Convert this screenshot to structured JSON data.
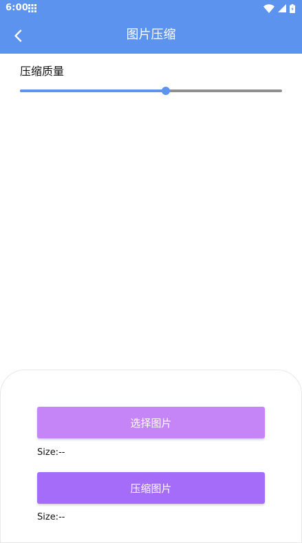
{
  "status_bar": {
    "time": "6:00"
  },
  "app_bar": {
    "title": "图片压缩",
    "color": "#5b93ee"
  },
  "quality": {
    "label": "压缩质量",
    "value_fraction": 0.556
  },
  "actions": {
    "select_label": "选择图片",
    "select_color": "#c685f6",
    "select_size": "Size:--",
    "compress_label": "压缩图片",
    "compress_color": "#a46cf8",
    "compress_size": "Size:--"
  },
  "icons": {
    "back": "back-arrow-icon",
    "grid": "grid-icon",
    "wifi": "wifi-icon",
    "signal": "signal-icon",
    "battery": "battery-icon"
  }
}
